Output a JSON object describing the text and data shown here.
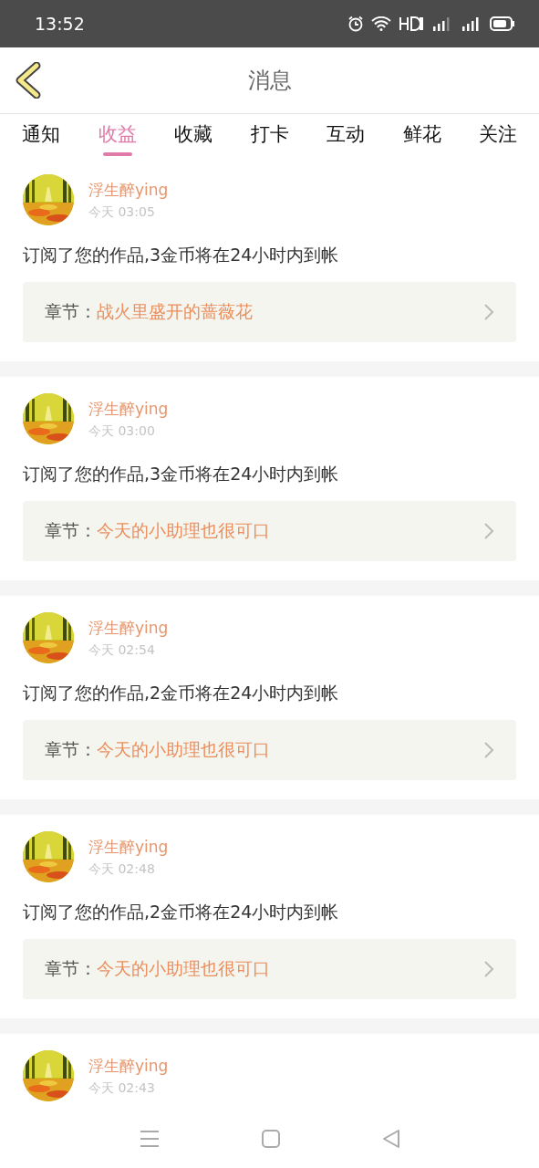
{
  "status_bar": {
    "time": "13:52"
  },
  "header": {
    "title": "消息"
  },
  "tabs": [
    {
      "label": "通知",
      "selected": false
    },
    {
      "label": "收益",
      "selected": true
    },
    {
      "label": "收藏",
      "selected": false
    },
    {
      "label": "打卡",
      "selected": false
    },
    {
      "label": "互动",
      "selected": false
    },
    {
      "label": "鲜花",
      "selected": false
    },
    {
      "label": "关注",
      "selected": false
    }
  ],
  "messages": [
    {
      "user": "浮生醉ying",
      "time": "今天 03:05",
      "text": "订阅了您的作品,3金币将在24小时内到帐",
      "chapter_label": "章节：",
      "chapter": "战火里盛开的蔷薇花"
    },
    {
      "user": "浮生醉ying",
      "time": "今天 03:00",
      "text": "订阅了您的作品,3金币将在24小时内到帐",
      "chapter_label": "章节：",
      "chapter": "今天的小助理也很可口"
    },
    {
      "user": "浮生醉ying",
      "time": "今天 02:54",
      "text": "订阅了您的作品,2金币将在24小时内到帐",
      "chapter_label": "章节：",
      "chapter": "今天的小助理也很可口"
    },
    {
      "user": "浮生醉ying",
      "time": "今天 02:48",
      "text": "订阅了您的作品,2金币将在24小时内到帐",
      "chapter_label": "章节：",
      "chapter": "今天的小助理也很可口"
    },
    {
      "user": "浮生醉ying",
      "time": "今天 02:43"
    }
  ]
}
